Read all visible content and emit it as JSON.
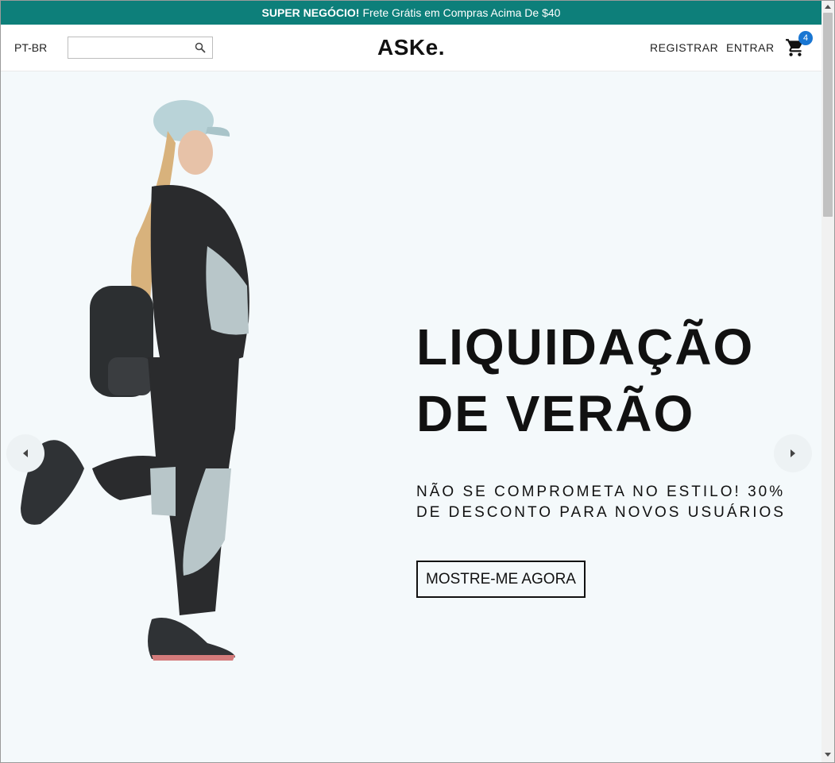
{
  "announcement": {
    "strong": "SUPER NEGÓCIO!",
    "text": "Frete Grátis em Compras Acima De $40"
  },
  "header": {
    "language": "PT-BR",
    "search": {
      "value": "",
      "placeholder": ""
    },
    "logo": "ASKe.",
    "register_label": "REGISTRAR",
    "login_label": "ENTRAR",
    "cart_count": "4"
  },
  "hero": {
    "title_line1": "LIQUIDAÇÃO",
    "title_line2": "DE VERÃO",
    "description_line1": "NÃO SE COMPROMETA NO ESTILO! 30%",
    "description_line2": "DE DESCONTO PARA NOVOS USUÁRIOS",
    "button_label": "MOSTRE-ME AGORA"
  },
  "colors": {
    "announce_bg": "#0d7f7a",
    "hero_bg": "#f4f9fb",
    "badge": "#1976d2"
  }
}
